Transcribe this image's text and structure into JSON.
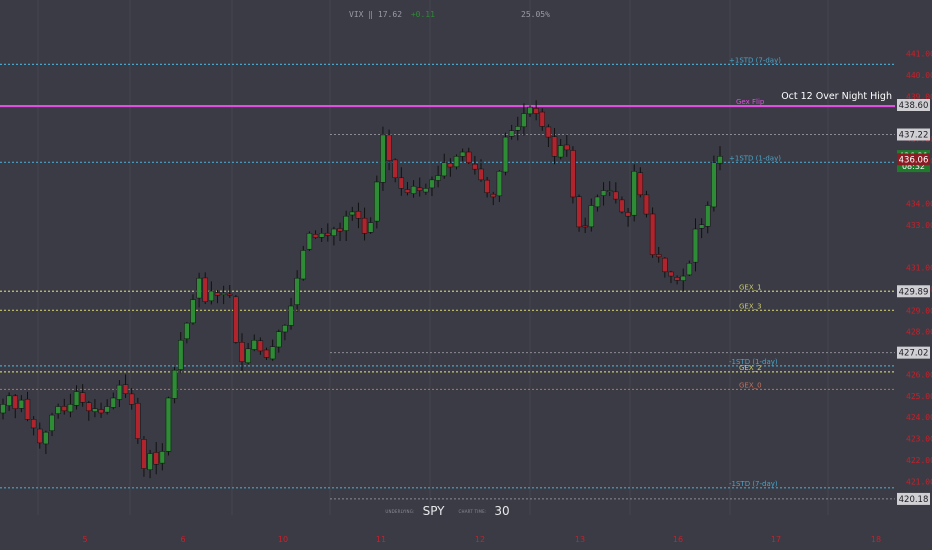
{
  "hud": {
    "vix_label": "VIX",
    "vix_value": "17.62",
    "vix_change": "+0.11",
    "pct_value": "25.05%"
  },
  "footer": {
    "underlying_caption": "UNDERLYING:",
    "underlying_value": "SPY",
    "chart_time_caption": "CHART TIME:",
    "chart_time_value": "30"
  },
  "colors": {
    "background": "#3a3b44",
    "candle_up": "#2e8b36",
    "candle_down": "#b0242e",
    "gex_flip": "#e050e0",
    "std_band": "#4aa3c8",
    "gex_levels": "#c8c870",
    "gex_0": "#c0705a",
    "grey_level": "#8a8b93",
    "axis_tick_red": "#cc1f2a"
  },
  "chart_data": {
    "type": "candlestick",
    "symbol": "SPY",
    "interval_minutes": 30,
    "ylim": [
      419.4,
      442.3
    ],
    "x_day_labels": [
      "5",
      "6",
      "10",
      "11",
      "12",
      "13",
      "16",
      "17",
      "18"
    ],
    "right_axis_ticks": [
      "441.00",
      "440.00",
      "439.00",
      "437.00",
      "436.00",
      "434.00",
      "433.00",
      "431.00",
      "430.00",
      "429.00",
      "428.00",
      "426.00",
      "425.00",
      "424.00",
      "423.00",
      "422.00",
      "421.00"
    ],
    "price_tags": [
      {
        "label": "438.60",
        "price": 438.6,
        "style": "grey"
      },
      {
        "label": "437.22",
        "price": 437.22,
        "style": "grey"
      },
      {
        "label": "436.21",
        "sub": "08:32",
        "price": 436.21,
        "style": "green"
      },
      {
        "label": "436.06",
        "price": 436.06,
        "style": "red"
      },
      {
        "label": "429.89",
        "price": 429.89,
        "style": "grey"
      },
      {
        "label": "427.02",
        "price": 427.02,
        "style": "grey"
      },
      {
        "label": "420.18",
        "price": 420.18,
        "style": "grey"
      }
    ],
    "levels": [
      {
        "label": "+1STD (7-day)",
        "price": 440.5,
        "style": "std"
      },
      {
        "label": "Gex Flip",
        "price": 438.55,
        "style": "flip"
      },
      {
        "label": "Oct 12 Over Night High",
        "price": 438.6,
        "style": "flip-note"
      },
      {
        "label": "",
        "price": 437.22,
        "style": "grey"
      },
      {
        "label": "+1STD (1-day)",
        "price": 435.92,
        "style": "std"
      },
      {
        "label": "GEX_1",
        "price": 429.89,
        "style": "gex"
      },
      {
        "label": "GEX_3",
        "price": 429.0,
        "style": "gex"
      },
      {
        "label": "",
        "price": 427.02,
        "style": "grey"
      },
      {
        "label": "-1STD (1-day)",
        "price": 426.4,
        "style": "std"
      },
      {
        "label": "GEX_2",
        "price": 426.12,
        "style": "gex"
      },
      {
        "label": "GEX_0",
        "price": 425.3,
        "style": "gex0"
      },
      {
        "label": "-1STD (7-day)",
        "price": 420.7,
        "style": "std"
      },
      {
        "label": "",
        "price": 420.18,
        "style": "grey"
      }
    ],
    "close_series": [
      424.6,
      425.0,
      424.4,
      424.8,
      423.9,
      423.5,
      422.8,
      423.3,
      424.1,
      424.5,
      424.3,
      424.6,
      425.2,
      424.7,
      424.3,
      424.4,
      424.2,
      424.5,
      424.9,
      425.5,
      425.1,
      424.6,
      423.0,
      421.6,
      422.3,
      421.8,
      422.4,
      424.9,
      426.2,
      427.6,
      428.4,
      429.5,
      430.5,
      429.4,
      429.9,
      429.7,
      429.8,
      429.7,
      427.5,
      426.6,
      427.2,
      427.6,
      427.1,
      426.8,
      427.3,
      428.0,
      428.3,
      429.2,
      430.5,
      431.8,
      432.6,
      432.4,
      432.6,
      432.5,
      432.8,
      432.7,
      433.4,
      433.6,
      433.3,
      432.6,
      433.1,
      435.0,
      437.2,
      436.0,
      435.2,
      434.7,
      434.5,
      434.8,
      434.6,
      434.7,
      435.1,
      435.3,
      435.9,
      435.7,
      436.2,
      436.4,
      435.9,
      435.6,
      435.1,
      434.5,
      434.3,
      435.5,
      437.1,
      437.4,
      437.6,
      438.2,
      438.5,
      438.2,
      437.6,
      437.1,
      436.2,
      436.7,
      436.5,
      434.3,
      432.9,
      432.9,
      433.9,
      434.3,
      434.6,
      434.6,
      434.2,
      433.6,
      433.4,
      435.5,
      434.4,
      433.5,
      431.6,
      431.5,
      430.8,
      430.6,
      430.4,
      430.6,
      431.2,
      432.8,
      433.0,
      433.9,
      435.9,
      436.2
    ]
  }
}
